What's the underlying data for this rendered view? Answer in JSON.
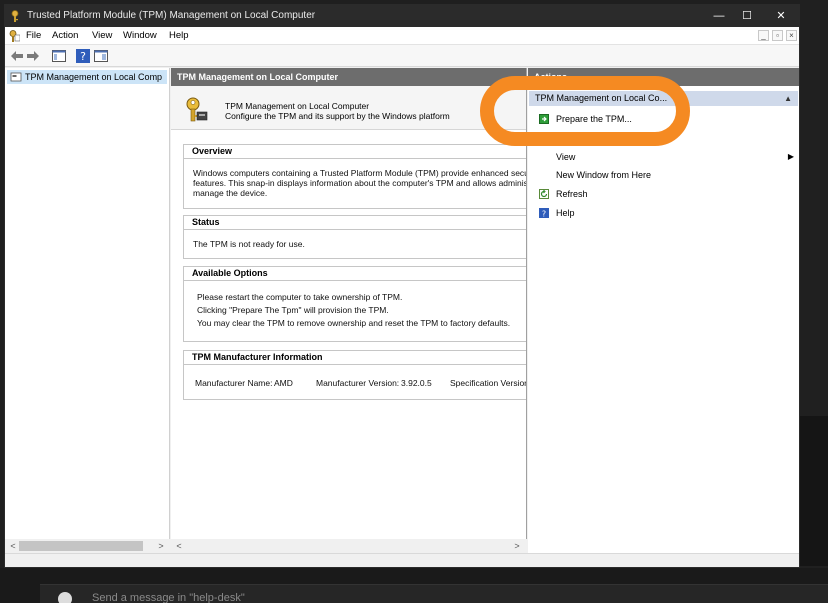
{
  "window": {
    "title": "Trusted Platform Module (TPM) Management on Local Computer",
    "controls": {
      "minimize": "—",
      "maximize": "☐",
      "close": "✕"
    }
  },
  "menubar": {
    "items": [
      "File",
      "Action",
      "View",
      "Window",
      "Help"
    ],
    "mdi": {
      "minimize": "_",
      "restore": "▫",
      "close": "×"
    }
  },
  "tree": {
    "item_label": "TPM Management on Local Comp"
  },
  "center": {
    "header": "TPM Management on Local Computer",
    "banner": {
      "title": "TPM Management on Local Computer",
      "description": "Configure the TPM and its support by the Windows platform"
    },
    "sections": {
      "overview": {
        "title": "Overview",
        "lines": [
          "Windows computers containing a Trusted Platform Module (TPM) provide enhanced security",
          "features. This snap-in displays information about the computer's TPM and allows administrat",
          "manage the device."
        ]
      },
      "status": {
        "title": "Status",
        "lines": [
          "The TPM is not ready for use."
        ]
      },
      "options": {
        "title": "Available Options",
        "lines": [
          "Please restart the computer to take ownership of TPM.",
          "Clicking \"Prepare The Tpm\" will provision the TPM.",
          "You may clear the TPM to remove ownership and reset the TPM to factory defaults."
        ]
      },
      "manufacturer": {
        "title": "TPM Manufacturer Information",
        "name_label": "Manufacturer Name:",
        "name_value": "AMD",
        "version_label": "Manufacturer Version:",
        "version_value": "3.92.0.5",
        "spec_label": "Specification Version:"
      }
    }
  },
  "actions": {
    "header": "Actions",
    "group_label": "TPM Management on Local Co...",
    "items": {
      "prepare": "Prepare the TPM...",
      "view": "View",
      "new_window": "New Window from Here",
      "refresh": "Refresh",
      "help": "Help"
    }
  },
  "scroll": {
    "left": "<",
    "right": ">"
  },
  "taskbar": {
    "prompt": "Send a message in \"help-desk\""
  },
  "colors": {
    "highlight": "#f58a22",
    "header_bg": "#6d6d6d",
    "selected": "#cce4f7"
  }
}
